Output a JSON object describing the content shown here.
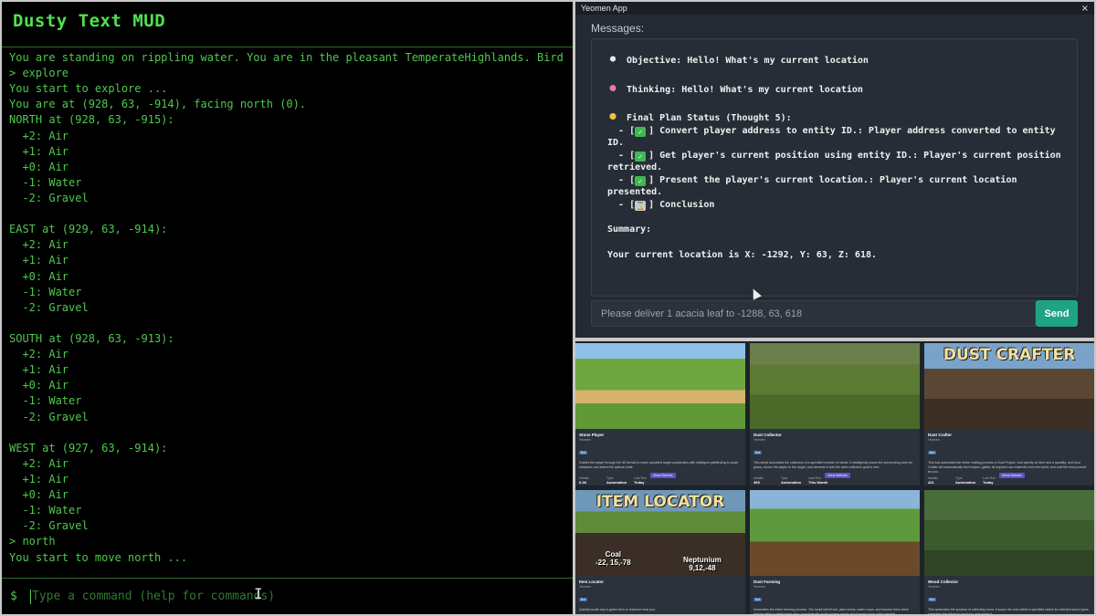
{
  "mud": {
    "title": "Dusty Text MUD",
    "lines": [
      "You are standing on rippling water. You are in the pleasant TemperateHighlands. Bird",
      "> explore",
      "You start to explore ...",
      "You are at (928, 63, -914), facing north (0).",
      "NORTH at (928, 63, -915):",
      "  +2: Air",
      "  +1: Air",
      "  +0: Air",
      "  -1: Water",
      "  -2: Gravel",
      "",
      "EAST at (929, 63, -914):",
      "  +2: Air",
      "  +1: Air",
      "  +0: Air",
      "  -1: Water",
      "  -2: Gravel",
      "",
      "SOUTH at (928, 63, -913):",
      "  +2: Air",
      "  +1: Air",
      "  +0: Air",
      "  -1: Water",
      "  -2: Gravel",
      "",
      "WEST at (927, 63, -914):",
      "  +2: Air",
      "  +1: Air",
      "  +0: Air",
      "  -1: Water",
      "  -2: Gravel",
      "> north",
      "You start to move north ..."
    ],
    "prompt": "$",
    "input_placeholder": "Type a command (help for commands)",
    "input_value": ""
  },
  "app": {
    "window_title": "Yeomen App",
    "close_glyph": "×",
    "messages_heading": "Messages:",
    "objective": "Objective: Hello! What's my current location",
    "thinking": "Thinking: Hello! What's my current location",
    "plan_status": "Final Plan Status (Thought 5):",
    "plan": [
      {
        "prefix": "  - [",
        "icon": "check",
        "text": "] Convert player address to entity ID.: Player address converted to entity ID."
      },
      {
        "prefix": "  - [",
        "icon": "check",
        "text": "] Get player's current position using entity ID.: Player's current position\nretrieved."
      },
      {
        "prefix": "  - [",
        "icon": "check",
        "text": "] Present the player's current location.: Player's current location presented."
      },
      {
        "prefix": "  - [",
        "icon": "hourglass",
        "text": "] Conclusion"
      }
    ],
    "summary_label": "Summary:",
    "summary_text": "Your current location is X: -1292, Y: 63, Z: 618.",
    "input_placeholder": "Please deliver 1 acacia leaf to -1288, 63, 618",
    "input_value": "",
    "send_label": "Send",
    "colors": {
      "accent": "#1fa386",
      "bg": "#232a33"
    }
  },
  "cards": [
    {
      "thumb_title": "",
      "name": "Stone Player",
      "sub": "Yeomen",
      "tag": "Bot",
      "desc": "Guides the player through the 3D terrain to reach specified target coordinates with intelligent pathfinding to avoid obstacles and select the optimal route.",
      "stats": [
        {
          "k": "Installs",
          "v": "6.2K"
        },
        {
          "k": "Type",
          "v": "Automation"
        },
        {
          "k": "Last Run",
          "v": "Today"
        }
      ],
      "button": "View Details",
      "overlay": []
    },
    {
      "thumb_title": "",
      "name": "Dust Collector",
      "sub": "Yeomen",
      "tag": "Bot",
      "desc": "This script automates the collection of a specified number of seeds. It intelligently scans the surrounding area for grass, moves the player to the target, and harvests it until the seed collection goal is met.",
      "stats": [
        {
          "k": "Installs",
          "v": "465"
        },
        {
          "k": "Type",
          "v": "Automation"
        },
        {
          "k": "Last Run",
          "v": "This Month"
        }
      ],
      "button": "View Details",
      "overlay": []
    },
    {
      "thumb_title": "DUST CRAFTER",
      "name": "Dust Crafter",
      "sub": "Yeomen",
      "tag": "Bot",
      "desc": "This tool automates the entire crafting process in Dust Project. Just specify an item and a quantity, and Dust Crafter will automatically find recipes, gather all required raw materials from the world, and craft the final product for you.",
      "stats": [
        {
          "k": "Installs",
          "v": "421"
        },
        {
          "k": "Type",
          "v": "Automation"
        },
        {
          "k": "Last Run",
          "v": "Today"
        }
      ],
      "button": "View Details",
      "overlay": []
    },
    {
      "thumb_title": "ITEM LOCATOR",
      "name": "Item Locator",
      "sub": "Yeomen",
      "tag": "Bot",
      "desc": "Quickly locate any in-game item or resource near you.",
      "stats": [
        {
          "k": "Installs",
          "v": ""
        },
        {
          "k": "Type",
          "v": ""
        },
        {
          "k": "Last Run",
          "v": ""
        }
      ],
      "button": "",
      "overlay": [
        {
          "line1": "Coal",
          "line2": "-22, 15,-78"
        },
        {
          "line1": "Neptunium",
          "line2": "9,12,-48"
        }
      ]
    },
    {
      "thumb_title": "",
      "name": "Dust Farming",
      "sub": "Yeomen",
      "tag": "Bot",
      "desc": "Automates the entire farming process. The script will till soil, plant seeds, water crops, and harvest them when mature within a designated area. It periodically works sowing seeds and harvest crops when needed.",
      "stats": [
        {
          "k": "Installs",
          "v": ""
        },
        {
          "k": "Type",
          "v": ""
        },
        {
          "k": "Last Run",
          "v": ""
        }
      ],
      "button": "",
      "overlay": []
    },
    {
      "thumb_title": "",
      "name": "Wood Collector",
      "sub": "Yeomen",
      "tag": "Bot",
      "desc": "This automates the process of collecting wood. It scans the area within a specified radius for selected wood types, navigates the player to each log, and mines it.",
      "stats": [
        {
          "k": "Installs",
          "v": ""
        },
        {
          "k": "Type",
          "v": ""
        },
        {
          "k": "Last Run",
          "v": ""
        }
      ],
      "button": "",
      "overlay": []
    }
  ]
}
